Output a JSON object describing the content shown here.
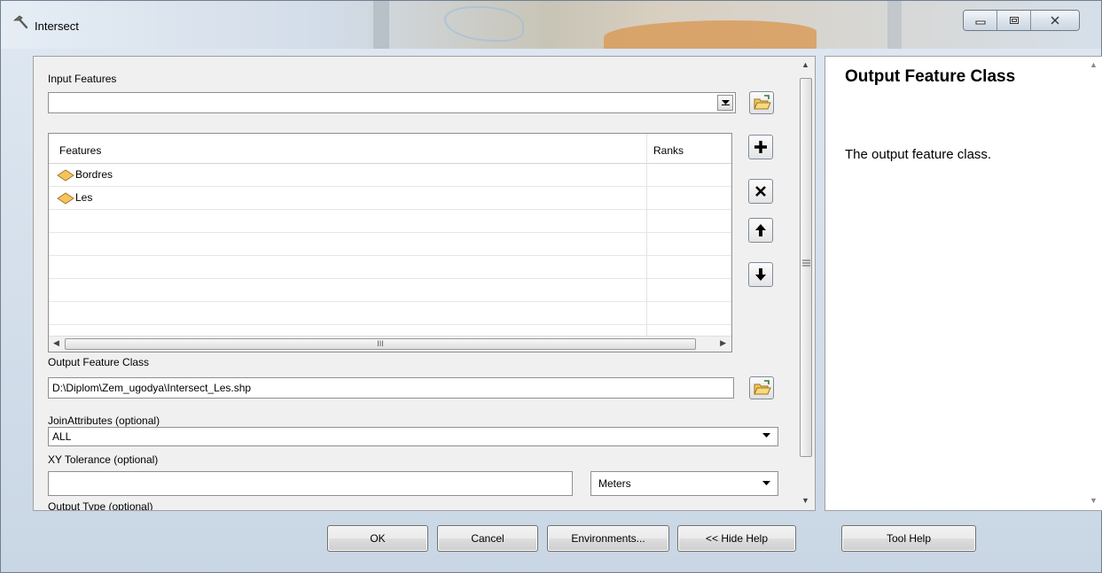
{
  "window": {
    "title": "Intersect",
    "icon": "hammer-icon",
    "controls": [
      "minimize-icon",
      "maximize-icon",
      "close-icon"
    ]
  },
  "params": {
    "input_features": {
      "label": "Input Features",
      "value": ""
    },
    "features_table": {
      "columns": [
        "Features",
        "Ranks"
      ],
      "rows": [
        {
          "feature": "Bordres",
          "rank": ""
        },
        {
          "feature": "Les",
          "rank": ""
        }
      ],
      "scroll_grip": "III"
    },
    "output_feature_class": {
      "label": "Output Feature Class",
      "value": "D:\\Diplom\\Zem_ugodya\\Intersect_Les.shp"
    },
    "join_attributes": {
      "label": "JoinAttributes (optional)",
      "value": "ALL"
    },
    "xy_tolerance": {
      "label": "XY Tolerance (optional)",
      "value": "",
      "unit": "Meters"
    },
    "output_type": {
      "label": "Output Type (optional)"
    },
    "side_buttons": [
      "add-icon",
      "remove-icon",
      "move-up-icon",
      "move-down-icon"
    ]
  },
  "help": {
    "title": "Output Feature Class",
    "text": "The output feature class."
  },
  "buttons": {
    "ok": "OK",
    "cancel": "Cancel",
    "environments": "Environments...",
    "hide_help": "<< Hide Help",
    "tool_help": "Tool Help"
  }
}
